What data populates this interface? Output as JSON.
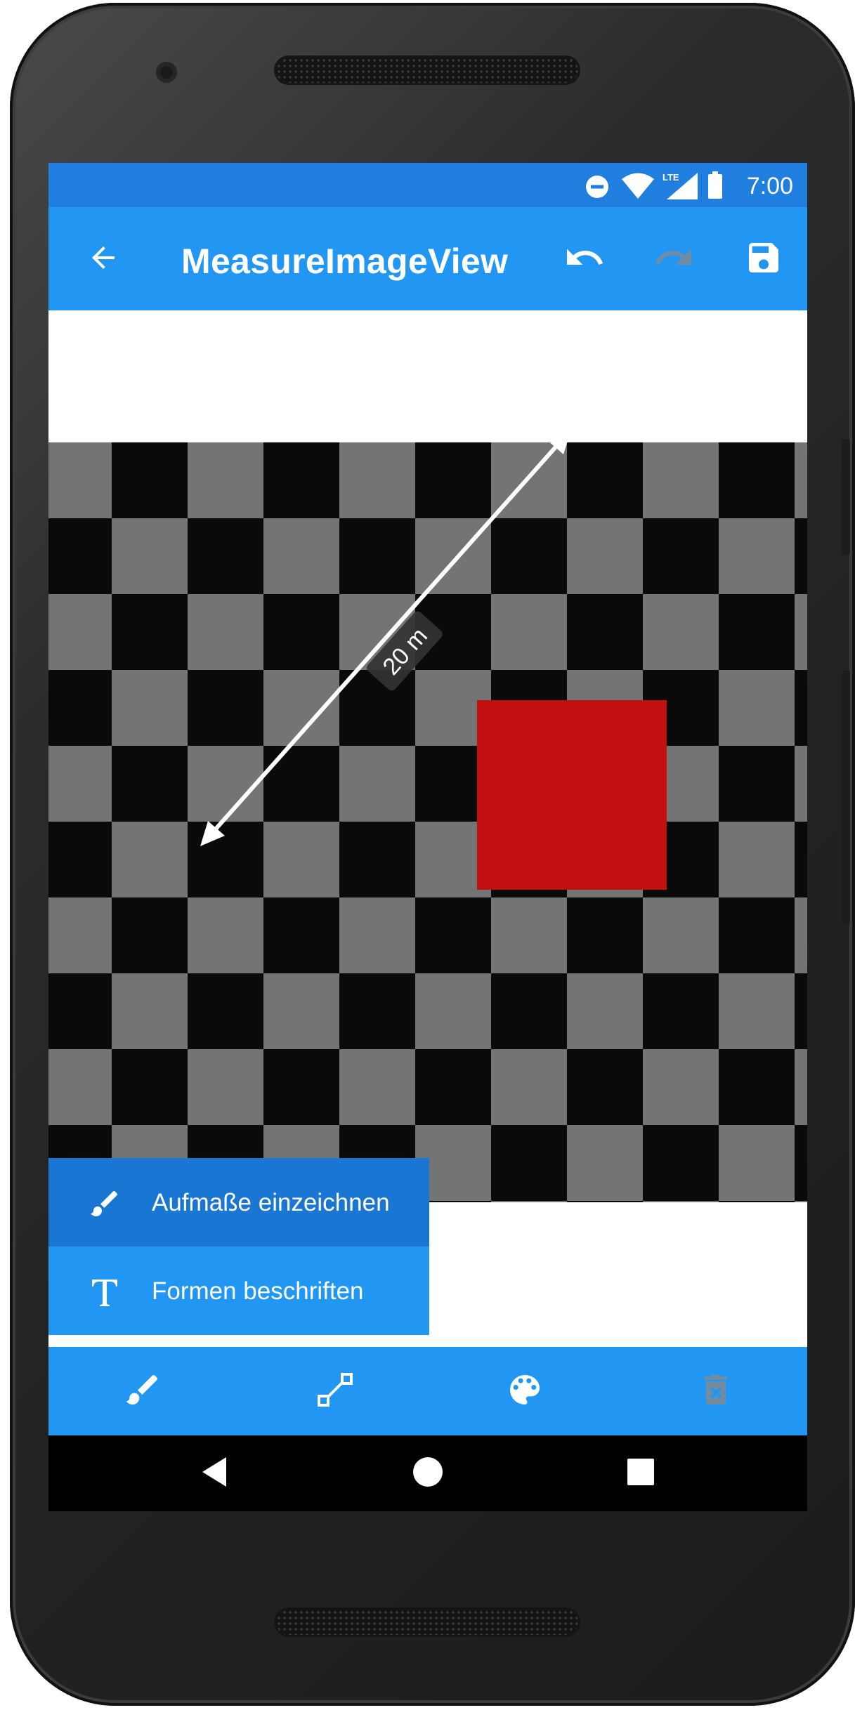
{
  "colors": {
    "status_bar": "#1f7ede",
    "app_bar": "#2196f3",
    "menu_selected": "#1976d2",
    "checker_dark": "#0a0a0a",
    "checker_light": "#747474",
    "red_square": "#c20f0f",
    "nav_bar": "#000000"
  },
  "status_bar": {
    "time": "7:00",
    "lte": "LTE",
    "icons": [
      "do-not-disturb-icon",
      "wifi-icon",
      "lte-signal-icon",
      "battery-icon"
    ]
  },
  "app_bar": {
    "title": "MeasureImageView",
    "icons": [
      "arrow-back-icon",
      "undo-icon",
      "redo-icon",
      "save-icon"
    ]
  },
  "canvas": {
    "measurement_label": "20 m"
  },
  "tool_menu": {
    "items": [
      {
        "label": "Aufmaße einzeichnen",
        "icon": "brush-icon",
        "selected": true
      },
      {
        "label": "Formen beschriften",
        "icon": "text-icon",
        "selected": false
      }
    ]
  },
  "bottom_toolbar": {
    "icons": [
      "brush-icon",
      "line-icon",
      "palette-icon",
      "delete-icon"
    ]
  },
  "nav_bar": {
    "icons": [
      "nav-back-icon",
      "nav-home-icon",
      "nav-recents-icon"
    ]
  }
}
